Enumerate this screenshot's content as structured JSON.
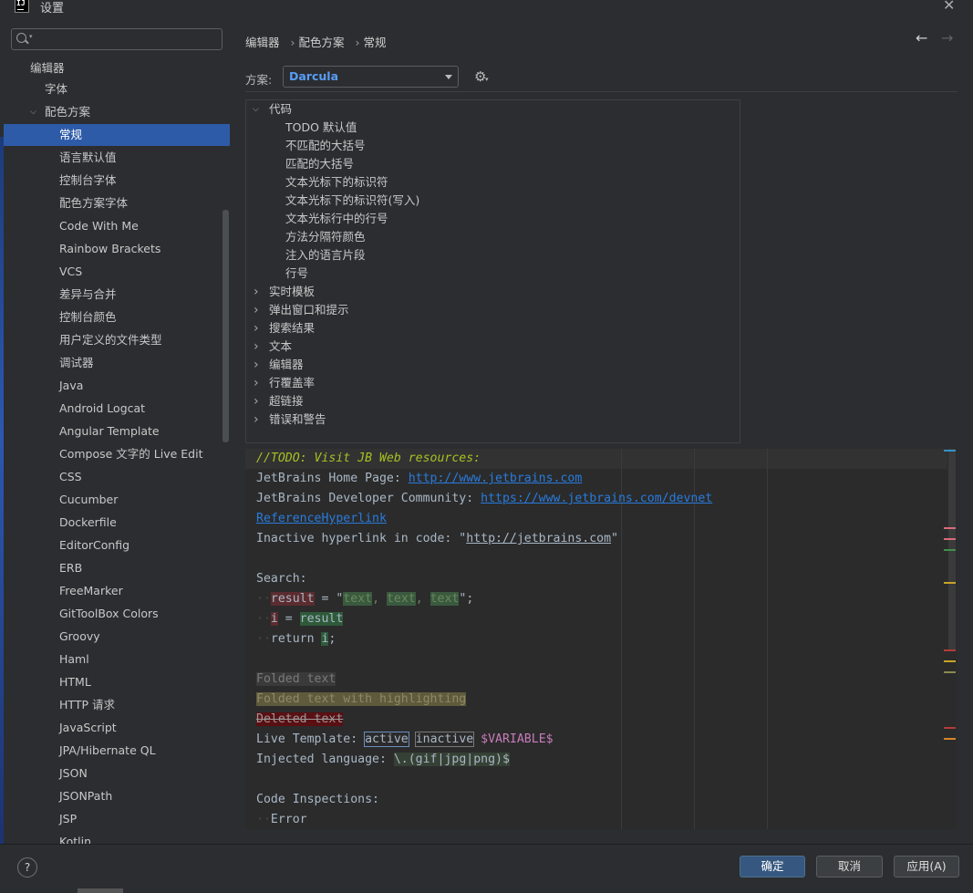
{
  "window": {
    "title": "设置",
    "app_icon": "IJ"
  },
  "sidebar": {
    "search_placeholder": "",
    "items": [
      {
        "label": "编辑器"
      },
      {
        "label": "字体"
      },
      {
        "label": "配色方案"
      },
      {
        "label": "常规"
      },
      {
        "label": "语言默认值"
      },
      {
        "label": "控制台字体"
      },
      {
        "label": "配色方案字体"
      },
      {
        "label": "Code With Me"
      },
      {
        "label": "Rainbow Brackets"
      },
      {
        "label": "VCS"
      },
      {
        "label": "差异与合并"
      },
      {
        "label": "控制台颜色"
      },
      {
        "label": "用户定义的文件类型"
      },
      {
        "label": "调试器"
      },
      {
        "label": "Java"
      },
      {
        "label": "Android Logcat"
      },
      {
        "label": "Angular Template"
      },
      {
        "label": "Compose 文字的 Live Edit"
      },
      {
        "label": "CSS"
      },
      {
        "label": "Cucumber"
      },
      {
        "label": "Dockerfile"
      },
      {
        "label": "EditorConfig"
      },
      {
        "label": "ERB"
      },
      {
        "label": "FreeMarker"
      },
      {
        "label": "GitToolBox Colors"
      },
      {
        "label": "Groovy"
      },
      {
        "label": "Haml"
      },
      {
        "label": "HTML"
      },
      {
        "label": "HTTP 请求"
      },
      {
        "label": "JavaScript"
      },
      {
        "label": "JPA/Hibernate QL"
      },
      {
        "label": "JSON"
      },
      {
        "label": "JSONPath"
      },
      {
        "label": "JSP"
      },
      {
        "label": "Kotlin"
      }
    ]
  },
  "breadcrumb": {
    "items": [
      "编辑器",
      "配色方案",
      "常规"
    ],
    "separator": "›"
  },
  "scheme": {
    "label": "方案:",
    "value": "Darcula"
  },
  "tree": {
    "items": [
      {
        "label": "代码",
        "expanded": true
      },
      {
        "label": "TODO 默认值"
      },
      {
        "label": "不匹配的大括号"
      },
      {
        "label": "匹配的大括号"
      },
      {
        "label": "文本光标下的标识符"
      },
      {
        "label": "文本光标下的标识符(写入)"
      },
      {
        "label": "文本光标行中的行号"
      },
      {
        "label": "方法分隔符颜色"
      },
      {
        "label": "注入的语言片段"
      },
      {
        "label": "行号"
      },
      {
        "label": "实时模板",
        "expanded": false
      },
      {
        "label": "弹出窗口和提示",
        "expanded": false
      },
      {
        "label": "搜索结果",
        "expanded": false
      },
      {
        "label": "文本",
        "expanded": false
      },
      {
        "label": "编辑器",
        "expanded": false
      },
      {
        "label": "行覆盖率",
        "expanded": false
      },
      {
        "label": "超链接",
        "expanded": false
      },
      {
        "label": "错误和警告",
        "expanded": false
      }
    ]
  },
  "preview": {
    "todo": "//TODO: Visit JB Web resources:",
    "home_label": "JetBrains Home Page: ",
    "home_url": "http://www.jetbrains.com",
    "dev_label": "JetBrains Developer Community: ",
    "dev_url": "https://www.jetbrains.com/devnet",
    "ref_link": "ReferenceHyperlink",
    "inactive_prefix": "Inactive hyperlink in code: \"",
    "inactive_url": "http://jetbrains.com",
    "inactive_suffix": "\"",
    "search_label": "Search:",
    "result_var": "result",
    "assign_eq": " = \"",
    "text_word": "text",
    "comma": ", ",
    "str_end": "\";",
    "i_var": "i",
    "eq": " = ",
    "return_kw": "return ",
    "semicolon": ";",
    "ws_dots": "··",
    "folded": "Folded text",
    "folded_hl": "Folded text with highlighting",
    "deleted": "Deleted text",
    "live_label": "Live Template: ",
    "tpl_active": "active",
    "tpl_inactive": "inactive",
    "tpl_var": "$VARIABLE$",
    "space": " ",
    "inj_label": "Injected language: ",
    "inj_value": "\\.(gif|jpg|png)$",
    "inspections": "Code Inspections:",
    "error": "Error"
  },
  "buttons": {
    "ok": "确定",
    "cancel": "取消",
    "apply": "应用(A)",
    "help": "?"
  },
  "colors": {
    "accent": "#2e5ba8",
    "link": "#287bde",
    "todo": "#a8c023",
    "scheme_value": "#589df6"
  }
}
